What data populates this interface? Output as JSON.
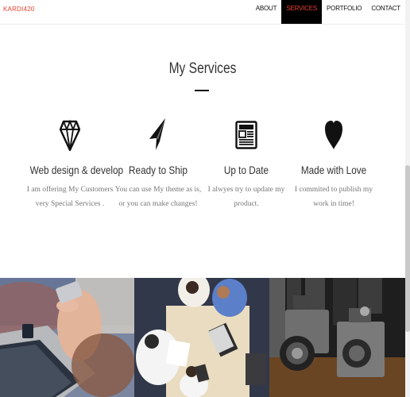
{
  "brand": "KARDI420",
  "nav": {
    "items": [
      {
        "label": "ABOUT"
      },
      {
        "label": "SERVICES"
      },
      {
        "label": "PORTFOLIO"
      },
      {
        "label": "CONTACT"
      }
    ],
    "active": "SERVICES"
  },
  "colors": {
    "accent": "#e8402e",
    "dark": "#111111"
  },
  "section": {
    "title": "My Services"
  },
  "services": [
    {
      "icon": "diamond-icon",
      "title": "Web design & develop",
      "desc": "I am offering My Customers very Special Services ."
    },
    {
      "icon": "paper-plane-icon",
      "title": "Ready to Ship",
      "desc": "You can use My theme as is, or you can make changes!"
    },
    {
      "icon": "newspaper-icon",
      "title": "Up to Date",
      "desc": "I alwyes try to update my product."
    },
    {
      "icon": "heart-icon",
      "title": "Made with Love",
      "desc": "I commited to publish my work in time!"
    }
  ],
  "photos": [
    {
      "subject": "hands-with-phone-and-laptop"
    },
    {
      "subject": "team-meeting-at-table"
    },
    {
      "subject": "vintage-cameras"
    }
  ]
}
